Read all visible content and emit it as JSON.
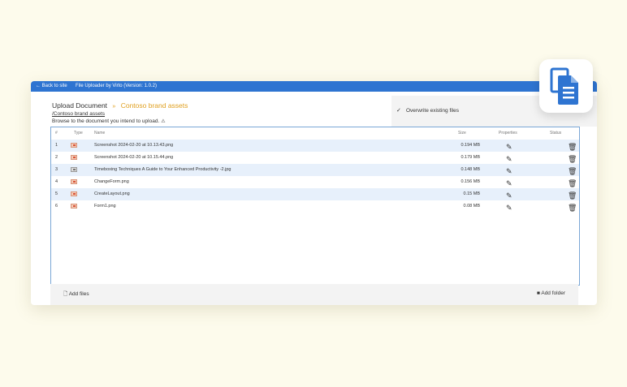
{
  "topbar": {
    "back_label": "← Back to site",
    "title": "File Uploader by Virto (Version: 1.0.2)"
  },
  "header": {
    "title": "Upload Document",
    "separator": "»",
    "library": "Contoso brand assets",
    "path": "/Contoso brand assets",
    "hint": "Browse to the document you intend to upload.",
    "warning_icon": "warning-icon"
  },
  "overwrite": {
    "label": "Overwrite existing files",
    "checked": true
  },
  "table": {
    "columns": {
      "num": "#",
      "type": "Type",
      "name": "Name",
      "size": "Size",
      "properties": "Properties",
      "status": "Status"
    },
    "rows": [
      {
        "num": "1",
        "name": "Screenshot 2024-02-20 at 10.13.43.png",
        "size": "0.194 MB",
        "icon": "image-file-icon"
      },
      {
        "num": "2",
        "name": "Screenshot 2024-02-20 at 10.15.44.png",
        "size": "0.179 MB",
        "icon": "image-file-icon"
      },
      {
        "num": "3",
        "name": "Timeboxing Techniques A Guide to Your Enhanced Productivity -2.jpg",
        "size": "0.148 MB",
        "icon": "generic-file-icon"
      },
      {
        "num": "4",
        "name": "ChangeForm.png",
        "size": "0.156 MB",
        "icon": "image-file-icon"
      },
      {
        "num": "5",
        "name": "CreateLayout.png",
        "size": "0.15 MB",
        "icon": "image-file-icon"
      },
      {
        "num": "6",
        "name": "Form1.png",
        "size": "0.08 MB",
        "icon": "image-file-icon"
      }
    ]
  },
  "footer": {
    "add_files": "Add files",
    "add_folder": "Add folder"
  },
  "colors": {
    "topbar": "#2e74d1",
    "accent": "#e0a020",
    "row_alt": "#e7f0fb",
    "grid_border": "#7aa7d6"
  },
  "badge": {
    "icon": "copy-documents-icon"
  }
}
